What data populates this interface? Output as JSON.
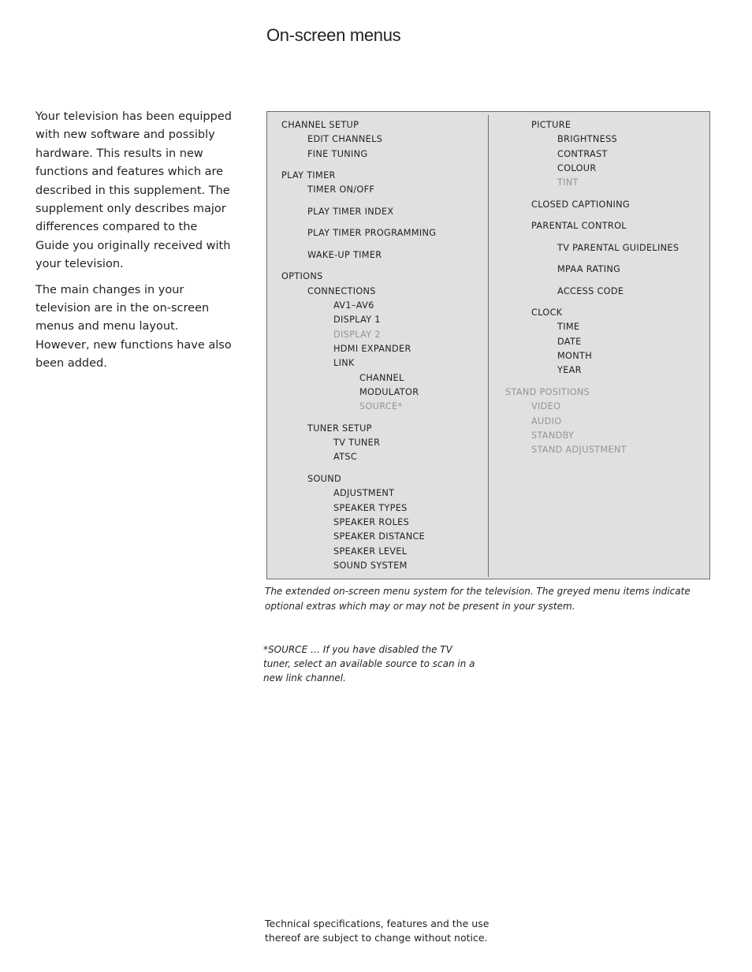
{
  "page": {
    "title": "On-screen menus"
  },
  "intro": {
    "paragraphs": [
      "Your television has been equipped with new software and possibly hardware. This results in new functions and features which are described in this supplement. The supplement only describes major differences compared to the Guide you originally received with your television.",
      "The main changes in your television are in the on-screen menus and menu layout. However, new functions have also been added."
    ]
  },
  "menu": {
    "left_column": [
      {
        "label": "CHANNEL SETUP",
        "level": 0,
        "optional": false
      },
      {
        "label": "EDIT CHANNELS",
        "level": 1,
        "optional": false
      },
      {
        "label": "FINE TUNING",
        "level": 1,
        "optional": false
      },
      {
        "label": "PLAY TIMER",
        "level": 0,
        "optional": false
      },
      {
        "label": "TIMER ON/OFF",
        "level": 1,
        "optional": false
      },
      {
        "label": "PLAY TIMER INDEX",
        "level": 1,
        "optional": false
      },
      {
        "label": "PLAY TIMER PROGRAMMING",
        "level": 1,
        "optional": false
      },
      {
        "label": "WAKE-UP TIMER",
        "level": 1,
        "optional": false
      },
      {
        "label": "OPTIONS",
        "level": 0,
        "optional": false
      },
      {
        "label": "CONNECTIONS",
        "level": 1,
        "optional": false
      },
      {
        "label": "AV1–AV6",
        "level": 2,
        "optional": false
      },
      {
        "label": "DISPLAY 1",
        "level": 2,
        "optional": false
      },
      {
        "label": "DISPLAY 2",
        "level": 2,
        "optional": true
      },
      {
        "label": "HDMI EXPANDER",
        "level": 2,
        "optional": false
      },
      {
        "label": "LINK",
        "level": 2,
        "optional": false
      },
      {
        "label": "CHANNEL",
        "level": 3,
        "optional": false
      },
      {
        "label": "MODULATOR",
        "level": 3,
        "optional": false
      },
      {
        "label": "SOURCE*",
        "level": 3,
        "optional": true
      },
      {
        "label": "TUNER SETUP",
        "level": 1,
        "optional": false
      },
      {
        "label": "TV TUNER",
        "level": 2,
        "optional": false
      },
      {
        "label": "ATSC",
        "level": 2,
        "optional": false
      },
      {
        "label": "SOUND",
        "level": 1,
        "optional": false
      },
      {
        "label": "ADJUSTMENT",
        "level": 2,
        "optional": false
      },
      {
        "label": "SPEAKER TYPES",
        "level": 2,
        "optional": false
      },
      {
        "label": "SPEAKER ROLES",
        "level": 2,
        "optional": false
      },
      {
        "label": "SPEAKER DISTANCE",
        "level": 2,
        "optional": false
      },
      {
        "label": "SPEAKER LEVEL",
        "level": 2,
        "optional": false
      },
      {
        "label": "SOUND SYSTEM",
        "level": 2,
        "optional": false
      }
    ],
    "right_column": [
      {
        "label": "PICTURE",
        "level": 1,
        "optional": false
      },
      {
        "label": "BRIGHTNESS",
        "level": 2,
        "optional": false
      },
      {
        "label": "CONTRAST",
        "level": 2,
        "optional": false
      },
      {
        "label": "COLOUR",
        "level": 2,
        "optional": false
      },
      {
        "label": "TINT",
        "level": 2,
        "optional": true
      },
      {
        "label": "CLOSED CAPTIONING",
        "level": 1,
        "optional": false
      },
      {
        "label": "PARENTAL CONTROL",
        "level": 1,
        "optional": false
      },
      {
        "label": "TV PARENTAL GUIDELINES",
        "level": 2,
        "optional": false
      },
      {
        "label": "MPAA RATING",
        "level": 2,
        "optional": false
      },
      {
        "label": "ACCESS CODE",
        "level": 2,
        "optional": false
      },
      {
        "label": "CLOCK",
        "level": 1,
        "optional": false
      },
      {
        "label": "TIME",
        "level": 2,
        "optional": false
      },
      {
        "label": "DATE",
        "level": 2,
        "optional": false
      },
      {
        "label": "MONTH",
        "level": 2,
        "optional": false
      },
      {
        "label": "YEAR",
        "level": 2,
        "optional": false
      },
      {
        "label": "STAND POSITIONS",
        "level": 0,
        "optional": true
      },
      {
        "label": "VIDEO",
        "level": 1,
        "optional": true
      },
      {
        "label": "AUDIO",
        "level": 1,
        "optional": true
      },
      {
        "label": "STANDBY",
        "level": 1,
        "optional": true
      },
      {
        "label": "STAND ADJUSTMENT",
        "level": 1,
        "optional": true
      }
    ],
    "colors": {
      "background": "#e0e0e0",
      "text": "#231f20",
      "optional_text": "#939598",
      "border": "#6d6e71"
    }
  },
  "caption": "The extended on-screen menu system for the television. The greyed menu items indicate optional extras which may or may not be present in your system.",
  "footnote": "*SOURCE … If you have disabled the TV tuner, select an available source to scan in a new link channel.",
  "disclaimer": "Technical specifications, features and the use thereof are subject to change without notice."
}
